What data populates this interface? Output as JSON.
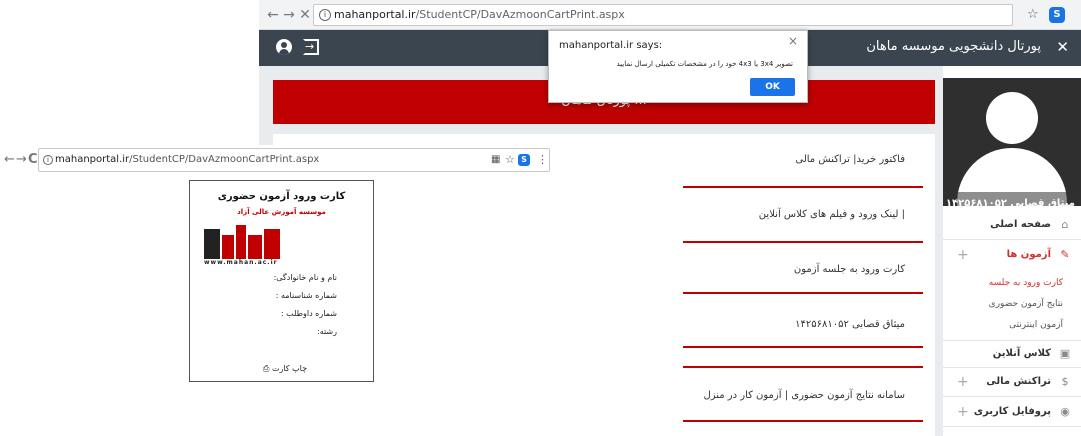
{
  "main_browser": {
    "url_host": "mahanportal.ir",
    "url_path": "/StudentCP/DavAzmoonCartPrint.aspx"
  },
  "header": {
    "title": "پورتال دانشجویی موسسه ماهان"
  },
  "sidebar": {
    "user_name": "میثاق قصابی ۱۴۲۵۶۸۱۰۵۲",
    "items": [
      {
        "label": "صفحه اصلی"
      },
      {
        "label": "آزمون ها"
      },
      {
        "label": "کلاس آنلاین"
      },
      {
        "label": "تراکنش مالی"
      },
      {
        "label": "پروفایل کاربری"
      }
    ],
    "sub_items": [
      {
        "label": "کارت ورود به جلسه"
      },
      {
        "label": "نتایج آزمون حضوری"
      },
      {
        "label": "آزمون اینترنتی"
      }
    ]
  },
  "banner": {
    "title": "... پورتال ماهان"
  },
  "content": {
    "links": [
      {
        "label": "فاکتور خرید| تراکنش مالی"
      },
      {
        "label": "| لینک ورود و فیلم های کلاس آنلاین"
      },
      {
        "label": "کارت ورود به جلسه آزمون"
      },
      {
        "label": "میثاق قصابی ۱۴۲۵۶۸۱۰۵۲"
      },
      {
        "label": "سامانه نتایج آزمون حضوری | آزمون کار در منزل"
      }
    ]
  },
  "alert": {
    "title": "mahanportal.ir says:",
    "message": "تصویر 3x4 یا 4x3 خود را در مشخصات تکمیلی ارسال نمایید",
    "ok_label": "OK"
  },
  "small_browser": {
    "url_host": "mahanportal.ir",
    "url_path": "/StudentCP/DavAzmoonCartPrint.aspx"
  },
  "card_print": {
    "title": "کارت ورود آزمون حضوری",
    "subtitle": "موسسه آموزش عالی آزاد",
    "website": "www.mahan.ac.ir",
    "fields": [
      {
        "label": "نام و نام خانوادگی:"
      },
      {
        "label": "شماره شناسنامه :"
      },
      {
        "label": "شماره داوطلب :"
      },
      {
        "label": "رشته:"
      }
    ],
    "print_label": "چاپ کارت"
  },
  "colors": {
    "brand_red": "#c00000",
    "header_dark": "#3b4550",
    "accent_blue": "#1a73e8"
  }
}
